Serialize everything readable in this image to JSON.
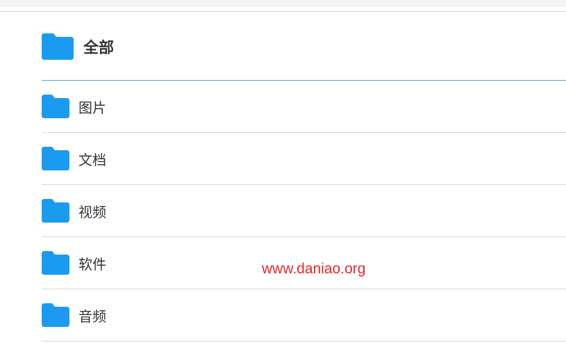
{
  "header": {
    "title": "全部",
    "icon": "folder-icon"
  },
  "folders": [
    {
      "label": "图片",
      "icon": "folder-icon"
    },
    {
      "label": "文档",
      "icon": "folder-icon"
    },
    {
      "label": "视频",
      "icon": "folder-icon"
    },
    {
      "label": "软件",
      "icon": "folder-icon"
    },
    {
      "label": "音频",
      "icon": "folder-icon"
    }
  ],
  "watermark": "www.daniao.org",
  "colors": {
    "folder": "#1b9bef",
    "header_underline": "#5a9ecf",
    "watermark": "#e8262b",
    "text": "#333333"
  }
}
